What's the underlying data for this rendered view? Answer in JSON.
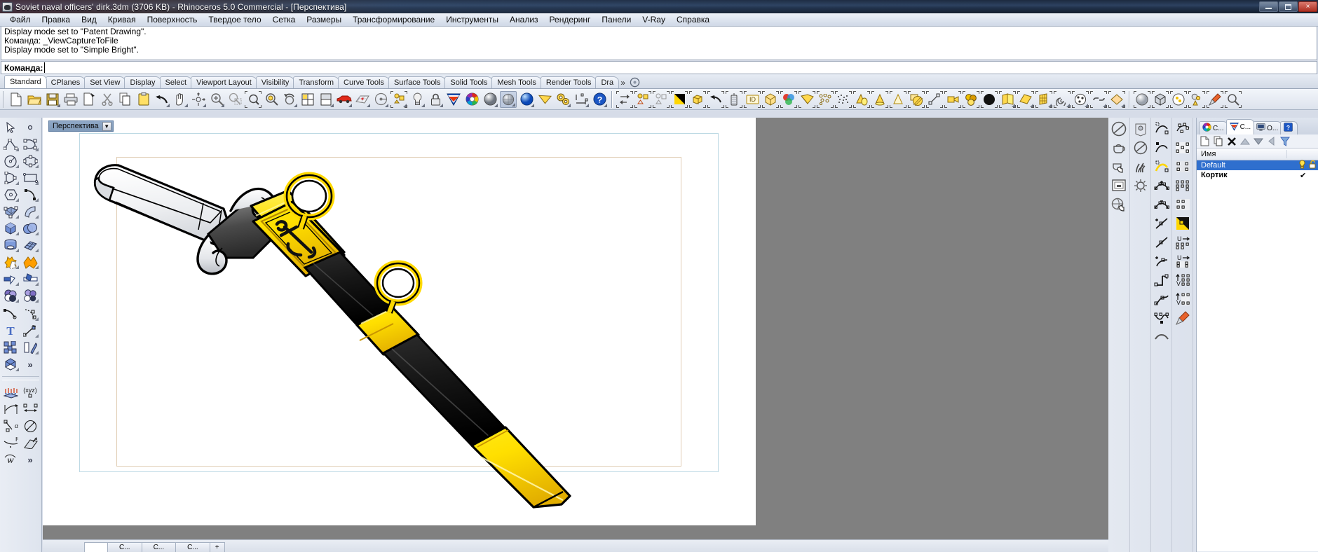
{
  "window": {
    "title": "Soviet naval officers' dirk.3dm (3706 KB) - Rhinoceros 5.0 Commercial - [Перспектива]",
    "app_icon": "rhino-icon",
    "minimize_label": "Свернуть",
    "maximize_label": "Развернуть",
    "close_label": "×"
  },
  "menu": {
    "items": [
      "Файл",
      "Правка",
      "Вид",
      "Кривая",
      "Поверхность",
      "Твердое тело",
      "Сетка",
      "Размеры",
      "Трансформирование",
      "Инструменты",
      "Анализ",
      "Рендеринг",
      "Панели",
      "V-Ray",
      "Справка"
    ]
  },
  "command_history": {
    "lines": [
      "Display mode set to \"Patent Drawing\".",
      "Команда: _ViewCaptureToFile",
      "Display mode set to \"Simple Bright\"."
    ]
  },
  "command_line": {
    "label": "Команда:",
    "value": "",
    "placeholder": ""
  },
  "toolbar_tabs": {
    "items": [
      "Standard",
      "CPlanes",
      "Set View",
      "Display",
      "Select",
      "Viewport Layout",
      "Visibility",
      "Transform",
      "Curve Tools",
      "Surface Tools",
      "Solid Tools",
      "Mesh Tools",
      "Render Tools",
      "Dra"
    ],
    "active": "Standard",
    "overflow": "»"
  },
  "main_toolbar": {
    "groups": [
      {
        "name": "file-group",
        "icons": [
          "new-file-icon",
          "open-folder-icon",
          "save-icon",
          "print-icon",
          "copy-to-clipboard-icon",
          "cut-icon",
          "copy-icon",
          "paste-icon"
        ]
      },
      {
        "name": "view-group",
        "icons": [
          "undo-icon",
          "pan-icon",
          "rotate-view-icon",
          "zoom-in-icon",
          "zoom-window-icon",
          "zoom-extents-icon",
          "zoom-selected-icon",
          "zoom-previous-icon",
          "four-view-icon",
          "split-view-icon"
        ]
      },
      {
        "name": "display-group",
        "icons": [
          "car-render-icon",
          "grid-snap-icon",
          "ortho-icon",
          "planar-icon",
          "light-icon",
          "lock-icon",
          "vray-icon",
          "color-wheel-icon",
          "shaded-sphere-icon",
          "ghosted-sphere-icon",
          "rendered-sphere-icon",
          "flat-shade-icon",
          "options-gear-icon",
          "dimension-icon",
          "help-icon"
        ]
      },
      {
        "name": "analysis-group",
        "icons": [
          "swap-objects-icon",
          "match-properties-icon",
          "match-layer-icon",
          "black-white-icon",
          "box-edit-icon",
          "undo-view-icon",
          "zebra-analysis-icon",
          "object-id-icon",
          "cube-solid-icon",
          "color-mix-icon",
          "surface-fold-icon",
          "point-cloud-icon",
          "scatter-points-icon",
          "material-cone-icon"
        ]
      },
      {
        "name": "render-group",
        "icons": [
          "cone-yellow-icon",
          "cone-outline-icon",
          "hatch-icon",
          "distance-icon",
          "camera-icon",
          "materials-icon",
          "black-sphere-icon",
          "fold-surface-icon",
          "plane-surface-icon",
          "mesh-plane-icon",
          "spiral-icon",
          "texture-ball-icon",
          "chain-link-icon",
          "gem-icon"
        ]
      },
      {
        "name": "vray-group",
        "icons": [
          "vray-sphere-icon",
          "vray-cube-icon",
          "vray-light-icon",
          "vray-material-icon",
          "vray-brush-icon",
          "vray-search-icon"
        ]
      }
    ]
  },
  "left_toolbar": {
    "groups": [
      {
        "name": "main-tools",
        "icons": [
          "select-arrow-icon",
          "point-icon",
          "polyline-icon",
          "curve-icon",
          "circle-icon",
          "ellipse-icon",
          "arc-icon",
          "rectangle-icon",
          "polygon-icon",
          "free-form-curve-icon",
          "surface-from-curves-icon",
          "surface-sweep-icon",
          "box-icon",
          "sphere-icon",
          "cylinder-icon",
          "mesh-icon",
          "boolean-union-icon",
          "explode-icon",
          "trim-icon",
          "split-icon",
          "blend-colors-icon",
          "point-colors-icon",
          "fillet-curve-icon",
          "blend-curve-icon",
          "text-icon",
          "scale-icon",
          "array-icon",
          "mirror-icon",
          "gumball-icon",
          "more-icon"
        ]
      },
      {
        "name": "dimension-tools",
        "icons": [
          "extrude-icon",
          "cplane-xyz-icon",
          "dim-aligned-icon",
          "dim-linear-icon",
          "dim-angle-icon",
          "dim-diameter-icon",
          "dim-radius-icon",
          "dim-leader-icon",
          "text-curve-icon",
          "more-icon"
        ]
      }
    ]
  },
  "right_toolbars": {
    "columns": [
      {
        "name": "render-display-col",
        "icons": [
          "no-render-icon",
          "teapot-icon",
          "teapot-hand-icon",
          "render-window-icon",
          "globe-hand-icon"
        ]
      },
      {
        "name": "render-options-col",
        "icons": [
          "render-settings-icon",
          "no-render-small-icon",
          "grass-icon",
          "sun-icon"
        ]
      },
      {
        "name": "curve-edit-col",
        "icons": [
          "curve-point-on-icon",
          "curve-point-off-icon",
          "curve-highlight-icon",
          "add-control-point-icon",
          "remove-control-point-icon",
          "insert-kink-icon",
          "curve-edit-icon",
          "insert-point-icon",
          "curve-corner-icon",
          "curve-smooth-icon",
          "curve-weight-icon",
          "curve-fair-icon"
        ]
      },
      {
        "name": "surface-points-col",
        "icons": [
          "surface-points-icon",
          "surface-grid-1-icon",
          "surface-grid-2-icon",
          "surface-grid-3-icon",
          "surface-grid-4-icon",
          "surface-black-white-icon",
          "surface-u-direction-icon",
          "surface-u-direction-2-icon",
          "surface-v-direction-icon",
          "surface-v-direction-2-icon",
          "surface-brush-icon"
        ]
      },
      {
        "name": "view-nav-col",
        "icons": [
          "axis-red-icon",
          "axis-green-icon",
          "set-cplane-icon",
          "set-cplane-2-icon",
          "puzzle-icon",
          "box-edit-2-icon",
          "work-person-icon",
          "view-left-icon",
          "view-zoom-icon",
          "view-right-icon"
        ]
      }
    ]
  },
  "viewport": {
    "name": "Перспектива",
    "caret": "▼",
    "background_color": "#808080",
    "page_color": "#ffffff",
    "blue_frame_color": "#bdd9e4",
    "tan_frame_color": "#e0cdb4",
    "model": {
      "name": "Soviet naval officers' dirk",
      "display_mode": "Simple Bright",
      "colors": {
        "gold": "#ffe000",
        "gold_dark": "#d9a800",
        "black": "#1b1b1b",
        "steel_light": "#f6f7f8",
        "steel_gray": "#4a4a4a",
        "outline": "#000000"
      }
    }
  },
  "layers_panel": {
    "tabs": [
      {
        "label": "C...",
        "icon": "color-wheel-icon",
        "active": false
      },
      {
        "label": "C...",
        "icon": "layers-icon",
        "active": true
      },
      {
        "label": "O...",
        "icon": "display-icon",
        "active": false
      },
      {
        "label": "",
        "icon": "help-icon",
        "active": false
      }
    ],
    "toolbar_icons": [
      "new-layer-icon",
      "copy-layer-icon",
      "delete-layer-icon",
      "move-up-icon",
      "move-down-icon",
      "back-icon",
      "filter-icon"
    ],
    "columns": [
      "Имя",
      "",
      ""
    ],
    "rows": [
      {
        "name": "Default",
        "selected": true,
        "bulb": "💡",
        "lock": "🔓",
        "check": ""
      },
      {
        "name": "Кортик",
        "selected": false,
        "bulb": "",
        "lock": "",
        "check": "✔"
      }
    ]
  },
  "status_tabs": {
    "items": [
      "",
      "C...",
      "C...",
      "C...",
      "+"
    ]
  }
}
